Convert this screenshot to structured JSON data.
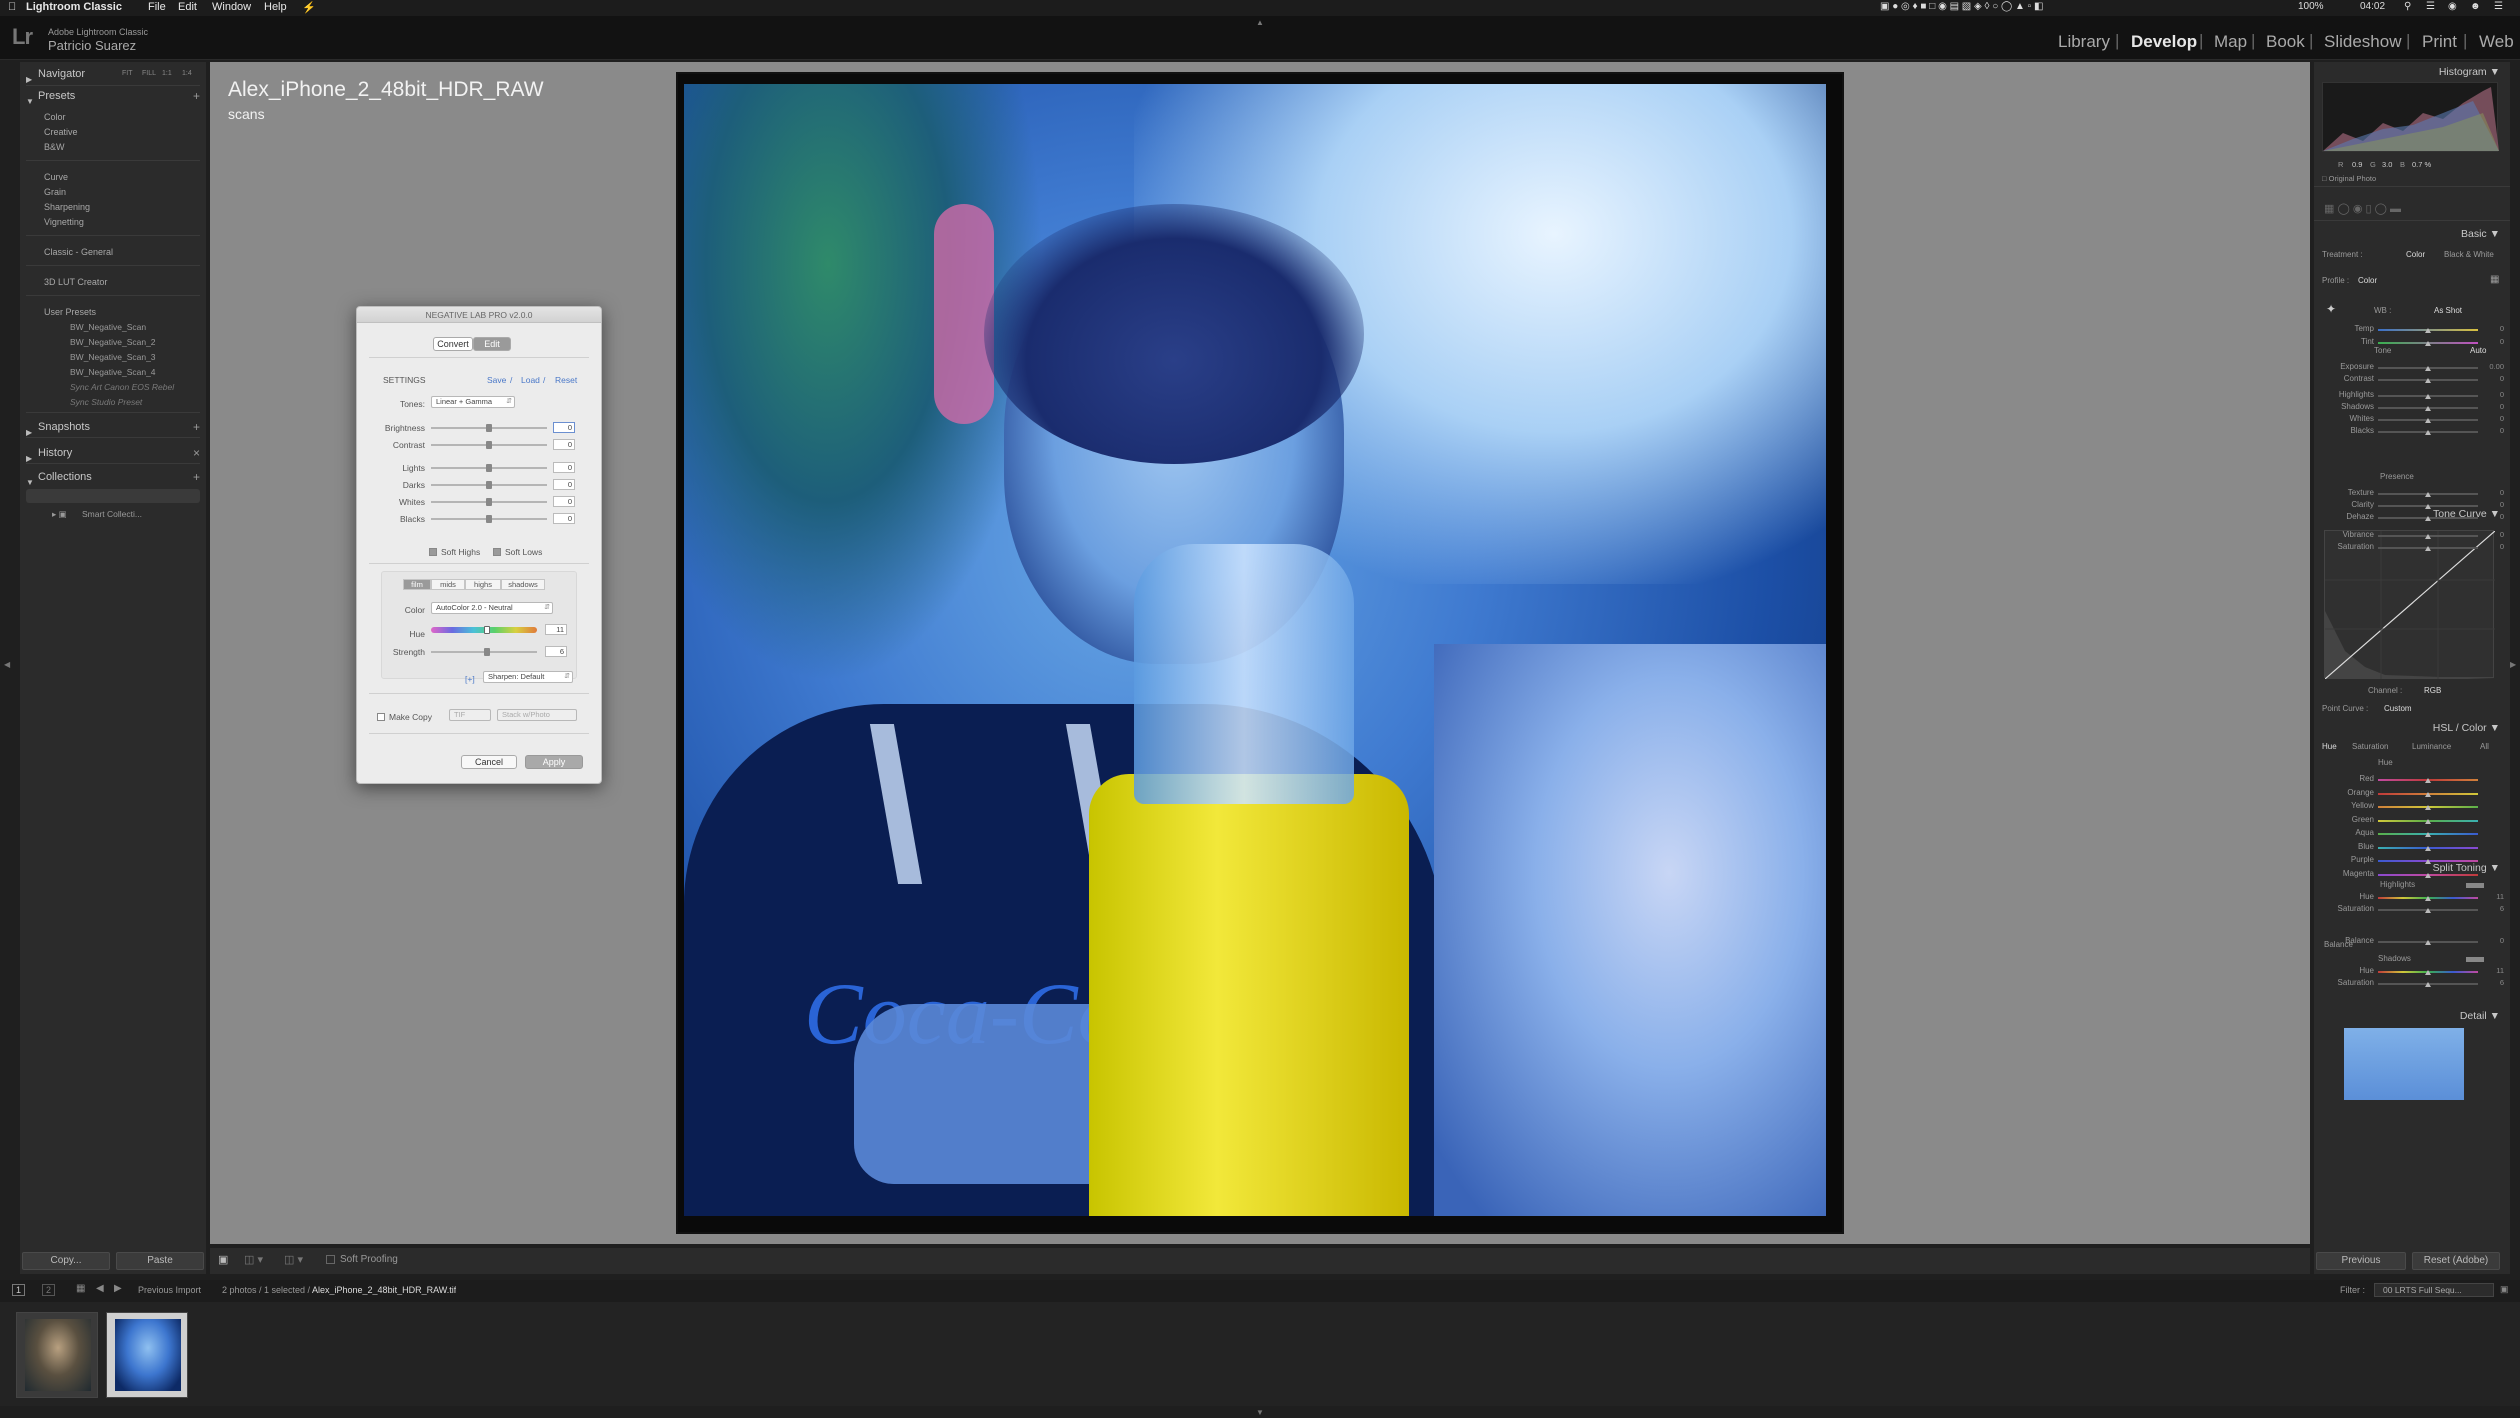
{
  "menubar": {
    "app": "Lightroom Classic",
    "items": [
      "File",
      "Edit",
      "Window",
      "Help"
    ],
    "battery": "100%",
    "time": "04:02"
  },
  "header": {
    "logo": "Lr",
    "product": "Adobe Lightroom Classic",
    "user": "Patricio Suarez",
    "modules": [
      "Library",
      "Develop",
      "Map",
      "Book",
      "Slideshow",
      "Print",
      "Web"
    ],
    "active_module": "Develop"
  },
  "left_panel": {
    "navigator": "Navigator",
    "nav_options": [
      "FIT",
      "FILL",
      "1:1",
      "1:4"
    ],
    "presets": "Presets",
    "preset_groups_a": [
      "Color",
      "Creative",
      "B&W"
    ],
    "preset_groups_b": [
      "Curve",
      "Grain",
      "Sharpening",
      "Vignetting"
    ],
    "preset_group_c": "Classic - General",
    "preset_group_d": "3D LUT Creator",
    "user_presets": "User Presets",
    "user_preset_items": [
      "BW_Negative_Scan",
      "BW_Negative_Scan_2",
      "BW_Negative_Scan_3",
      "BW_Negative_Scan_4",
      "Sync Art Canon EOS Rebel",
      "Sync Studio Preset"
    ],
    "snapshots": "Snapshots",
    "history": "History",
    "collections": "Collections",
    "smart_collection": "Smart Collecti...",
    "copy_btn": "Copy...",
    "paste_btn": "Paste"
  },
  "image": {
    "title": "Alex_iPhone_2_48bit_HDR_RAW",
    "folder": "scans"
  },
  "dialog": {
    "title": "NEGATIVE LAB PRO v2.0.0",
    "tabs": [
      "Convert",
      "Edit"
    ],
    "settings": "SETTINGS",
    "save": "Save",
    "load": "Load",
    "reset": "Reset",
    "slash": "/",
    "tones_label": "Tones:",
    "tones_value": "Linear + Gamma",
    "sliders": [
      {
        "label": "Brightness",
        "value": "0"
      },
      {
        "label": "Contrast",
        "value": "0"
      },
      {
        "label": "Lights",
        "value": "0"
      },
      {
        "label": "Darks",
        "value": "0"
      },
      {
        "label": "Whites",
        "value": "0"
      },
      {
        "label": "Blacks",
        "value": "0"
      }
    ],
    "soft_highs": "Soft Highs",
    "soft_lows": "Soft Lows",
    "segments": [
      "film",
      "mids",
      "highs",
      "shadows"
    ],
    "color_label": "Color",
    "color_value": "AutoColor 2.0 - Neutral",
    "hue_label": "Hue",
    "hue_value": "11",
    "strength_label": "Strength",
    "strength_value": "6",
    "sharpen_prefix": "[+]",
    "sharpen_value": "Sharpen: Default",
    "make_copy": "Make Copy",
    "format_value": "TIF",
    "stack_value": "Stack w/Photo",
    "cancel": "Cancel",
    "apply": "Apply"
  },
  "right_panel": {
    "histogram": "Histogram",
    "hist_readout": [
      "R",
      "0.9",
      "G",
      "3.0",
      "B",
      "0.7 %"
    ],
    "original_photo": "Original Photo",
    "basic": "Basic",
    "treatment_label": "Treatment :",
    "treatment_color": "Color",
    "treatment_bw": "Black & White",
    "profile_label": "Profile :",
    "profile_value": "Color",
    "wb_label": "WB :",
    "wb_value": "As Shot",
    "wb_sliders": [
      {
        "label": "Temp",
        "value": "0"
      },
      {
        "label": "Tint",
        "value": "0"
      }
    ],
    "tone": "Tone",
    "auto": "Auto",
    "tone_sliders": [
      {
        "label": "Exposure",
        "value": "0.00"
      },
      {
        "label": "Contrast",
        "value": "0"
      },
      {
        "label": "Highlights",
        "value": "0"
      },
      {
        "label": "Shadows",
        "value": "0"
      },
      {
        "label": "Whites",
        "value": "0"
      },
      {
        "label": "Blacks",
        "value": "0"
      }
    ],
    "presence": "Presence",
    "presence_sliders": [
      {
        "label": "Texture",
        "value": "0"
      },
      {
        "label": "Clarity",
        "value": "0"
      },
      {
        "label": "Dehaze",
        "value": "0"
      },
      {
        "label": "Vibrance",
        "value": "0"
      },
      {
        "label": "Saturation",
        "value": "0"
      }
    ],
    "tone_curve": "Tone Curve",
    "channel_label": "Channel :",
    "channel_value": "RGB",
    "point_curve_label": "Point Curve :",
    "point_curve_value": "Custom",
    "hsl": "HSL / Color",
    "hsl_tabs": [
      "Hue",
      "Saturation",
      "Luminance",
      "All"
    ],
    "hsl_section": "Hue",
    "hsl_colors": [
      "Red",
      "Orange",
      "Yellow",
      "Green",
      "Aqua",
      "Blue",
      "Purple",
      "Magenta"
    ],
    "split_toning": "Split Toning",
    "st_highlights": "Highlights",
    "st_h_hue": {
      "label": "Hue",
      "value": "11"
    },
    "st_h_sat": {
      "label": "Saturation",
      "value": "6"
    },
    "balance": {
      "label": "Balance",
      "value": "0"
    },
    "st_shadows": "Shadows",
    "st_s_hue": {
      "label": "Hue",
      "value": "11"
    },
    "st_s_sat": {
      "label": "Saturation",
      "value": "6"
    },
    "detail": "Detail",
    "previous": "Previous",
    "reset_adobe": "Reset (Adobe)"
  },
  "toolbar": {
    "soft_proofing": "Soft Proofing"
  },
  "filmstrip": {
    "page1": "1",
    "page2": "2",
    "source": "Previous Import",
    "count": "2 photos / 1 selected /",
    "filename": "Alex_iPhone_2_48bit_HDR_RAW.tif",
    "filter_label": "Filter :",
    "filter_value": "00 LRTS Full Sequ..."
  },
  "colors": {
    "accent_film": "#1c4fa6",
    "dialog_bg": "#ececec"
  }
}
